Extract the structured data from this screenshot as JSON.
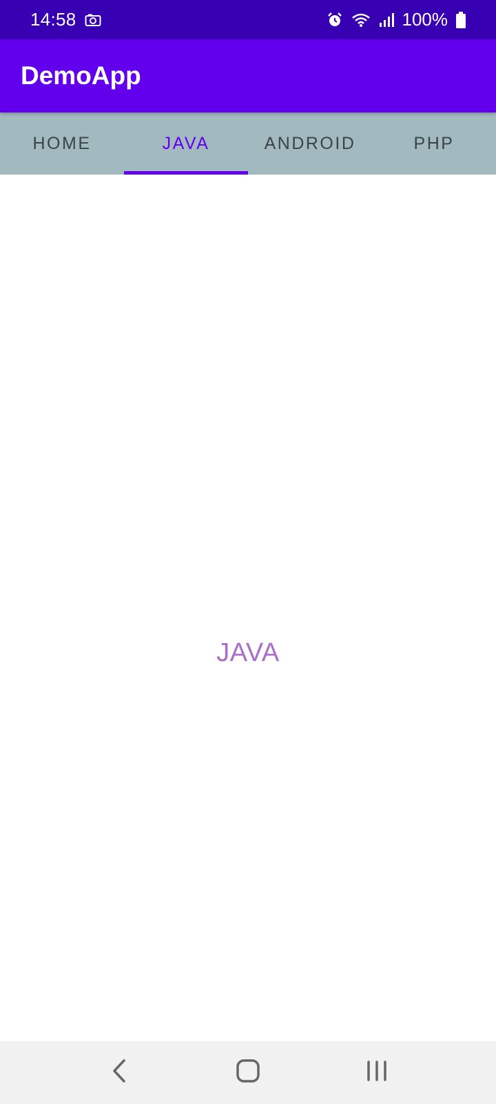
{
  "status_bar": {
    "time": "14:58",
    "battery": "100%",
    "icons": [
      "camera-icon",
      "alarm-icon",
      "wifi-icon",
      "signal-icon",
      "battery-icon"
    ]
  },
  "app_bar": {
    "title": "DemoApp",
    "color": "#6200ee"
  },
  "tabs": [
    {
      "label": "HOME",
      "active": false
    },
    {
      "label": "JAVA",
      "active": true
    },
    {
      "label": "ANDROID",
      "active": false
    },
    {
      "label": "PHP",
      "active": false
    }
  ],
  "content": {
    "text": "JAVA"
  },
  "nav_bar": {
    "icons": [
      "back-icon",
      "home-icon",
      "recents-icon"
    ]
  },
  "colors": {
    "status_bar": "#3700b3",
    "primary": "#6200ee",
    "tab_background": "#a1b9bf",
    "content_text": "#a86ec8"
  }
}
